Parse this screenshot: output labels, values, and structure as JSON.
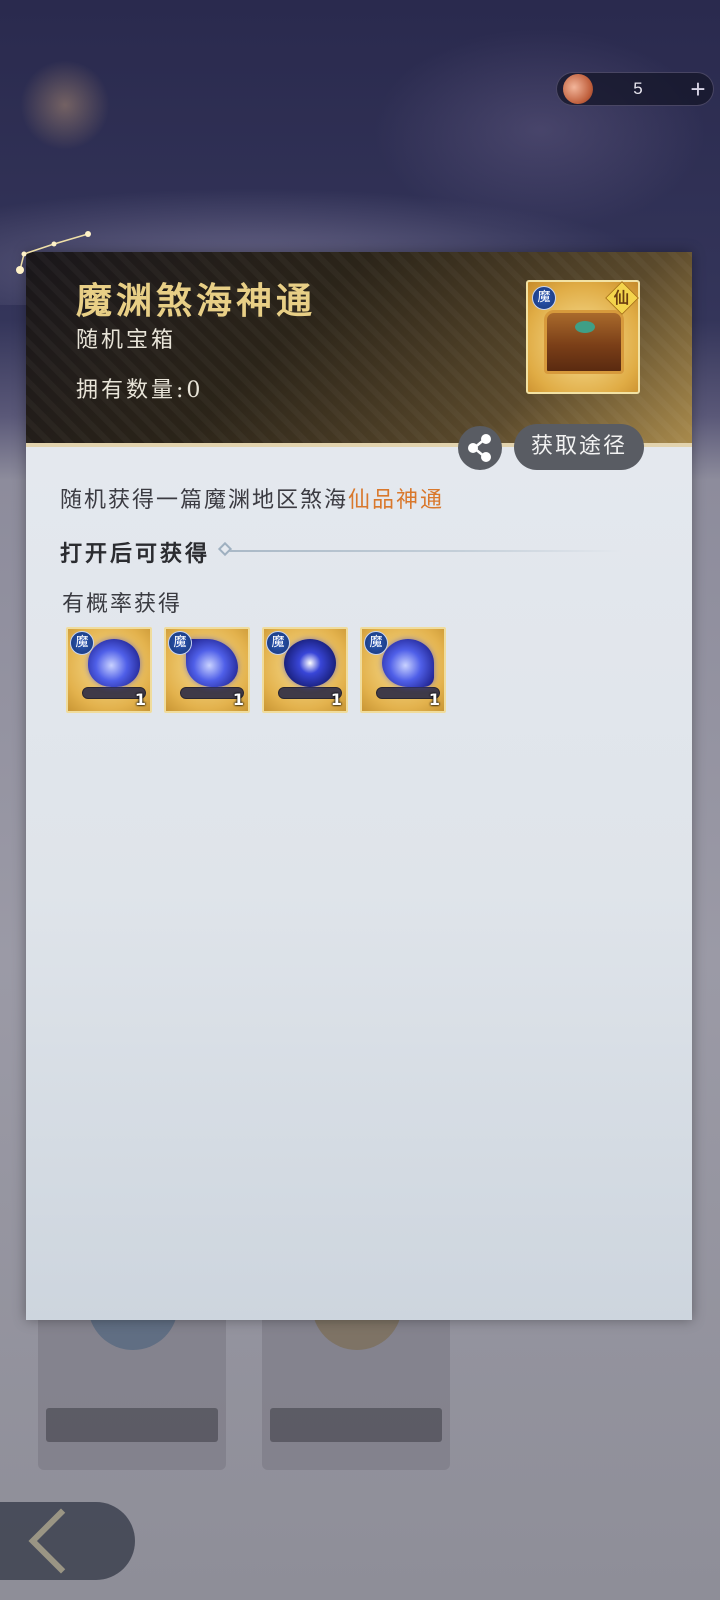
{
  "background": {
    "title": "",
    "subtitle": ""
  },
  "currency": {
    "icon": "feather-currency-icon",
    "value": "5",
    "add_label": "+"
  },
  "item": {
    "name": "魔渊煞海神通",
    "type": "随机宝箱",
    "owned_label": "拥有数量:0",
    "icon": "treasure-chest-icon",
    "region_badge": "魔",
    "grade_badge": "仙"
  },
  "actions": {
    "share_icon": "share-icon",
    "obtain_label": "获取途径"
  },
  "description": {
    "text": "随机获得一篇魔渊地区煞海",
    "highlight": "仙品神通",
    "highlight_color": "#d9782c"
  },
  "section": {
    "title": "打开后可获得",
    "subtitle": "有概率获得"
  },
  "rewards": [
    {
      "badge": "魔",
      "qty": "1",
      "icon": "blue-flame-scroll-icon"
    },
    {
      "badge": "魔",
      "qty": "1",
      "icon": "blue-feather-scroll-icon"
    },
    {
      "badge": "魔",
      "qty": "1",
      "icon": "blue-vortex-scroll-icon"
    },
    {
      "badge": "魔",
      "qty": "1",
      "icon": "blue-fire-scroll-icon"
    }
  ]
}
